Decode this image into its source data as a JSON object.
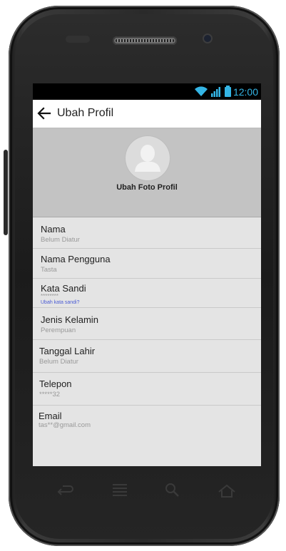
{
  "status_bar": {
    "time": "12:00"
  },
  "app_bar": {
    "title": "Ubah Profil"
  },
  "profile_header": {
    "change_photo_label": "Ubah Foto Profil"
  },
  "fields": {
    "nama": {
      "label": "Nama",
      "value": "Belum Diatur"
    },
    "nama_pengguna": {
      "label": "Nama Pengguna",
      "value": "Tasta"
    },
    "kata_sandi": {
      "label": "Kata Sandi",
      "value": "********",
      "link": "Ubah kata sandi?"
    },
    "jenis_kelamin": {
      "label": "Jenis Kelamin",
      "value": "Perempuan"
    },
    "tanggal_lahir": {
      "label": "Tanggal Lahir",
      "value": "Belum Diatur"
    },
    "telepon": {
      "label": "Telepon",
      "value": "*****32"
    },
    "email": {
      "label": "Email",
      "value": "tas**@gmail.com"
    }
  },
  "icons": {
    "back": "arrow-left-icon",
    "wifi": "wifi-icon",
    "signal": "signal-icon",
    "battery": "battery-icon",
    "avatar": "person-icon",
    "nav_back": "back-key-icon",
    "nav_menu": "menu-key-icon",
    "nav_search": "search-key-icon",
    "nav_home": "home-key-icon"
  },
  "colors": {
    "accent": "#34b5e5",
    "link": "#4a5bd4",
    "header_bg": "#c3c3c3",
    "list_bg": "#e4e4e4"
  }
}
